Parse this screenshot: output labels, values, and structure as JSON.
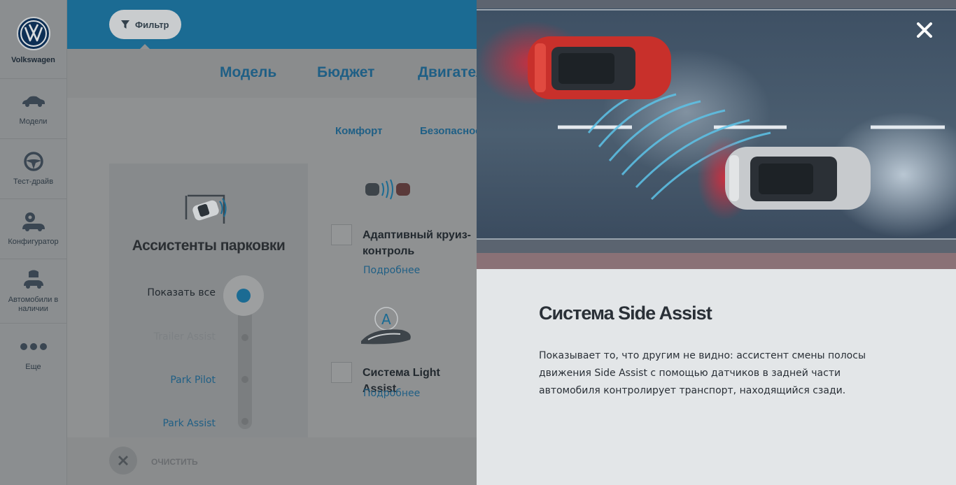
{
  "sidebar": {
    "brand": "Volkswagen",
    "items": [
      {
        "label": "Модели",
        "icon": "car-icon"
      },
      {
        "label": "Тест-драйв",
        "icon": "steering-wheel-icon"
      },
      {
        "label": "Конфигуратор",
        "icon": "configurator-icon"
      },
      {
        "label": "Автомобили в наличии",
        "icon": "car-stock-icon"
      },
      {
        "label": "Еще",
        "icon": "more-icon"
      }
    ]
  },
  "header": {
    "filter_label": "Фильтр"
  },
  "tabs": [
    "Модель",
    "Бюджет",
    "Двигатель"
  ],
  "subtabs": [
    "Комфорт",
    "Безопасность"
  ],
  "parking": {
    "title": "Ассистенты парковки",
    "show_all": "Показать все",
    "options": [
      "Trailer Assist",
      "Park Pilot",
      "Park Assist"
    ]
  },
  "features": [
    {
      "name": "Адаптивный круиз-контроль",
      "more": "Подробнее"
    },
    {
      "name": "Система Light Assist",
      "more": "Подробнее"
    }
  ],
  "footer": {
    "clear_label": "ОЧИСТИТЬ"
  },
  "modal": {
    "title": "Система Side Assist",
    "description": "Показывает то, что другим не видно: ассистент смены полосы движения Side Assist с помощью датчиков в задней части автомобиля контролирует транспорт, находящийся сзади.",
    "accent": "#1b6b93"
  }
}
